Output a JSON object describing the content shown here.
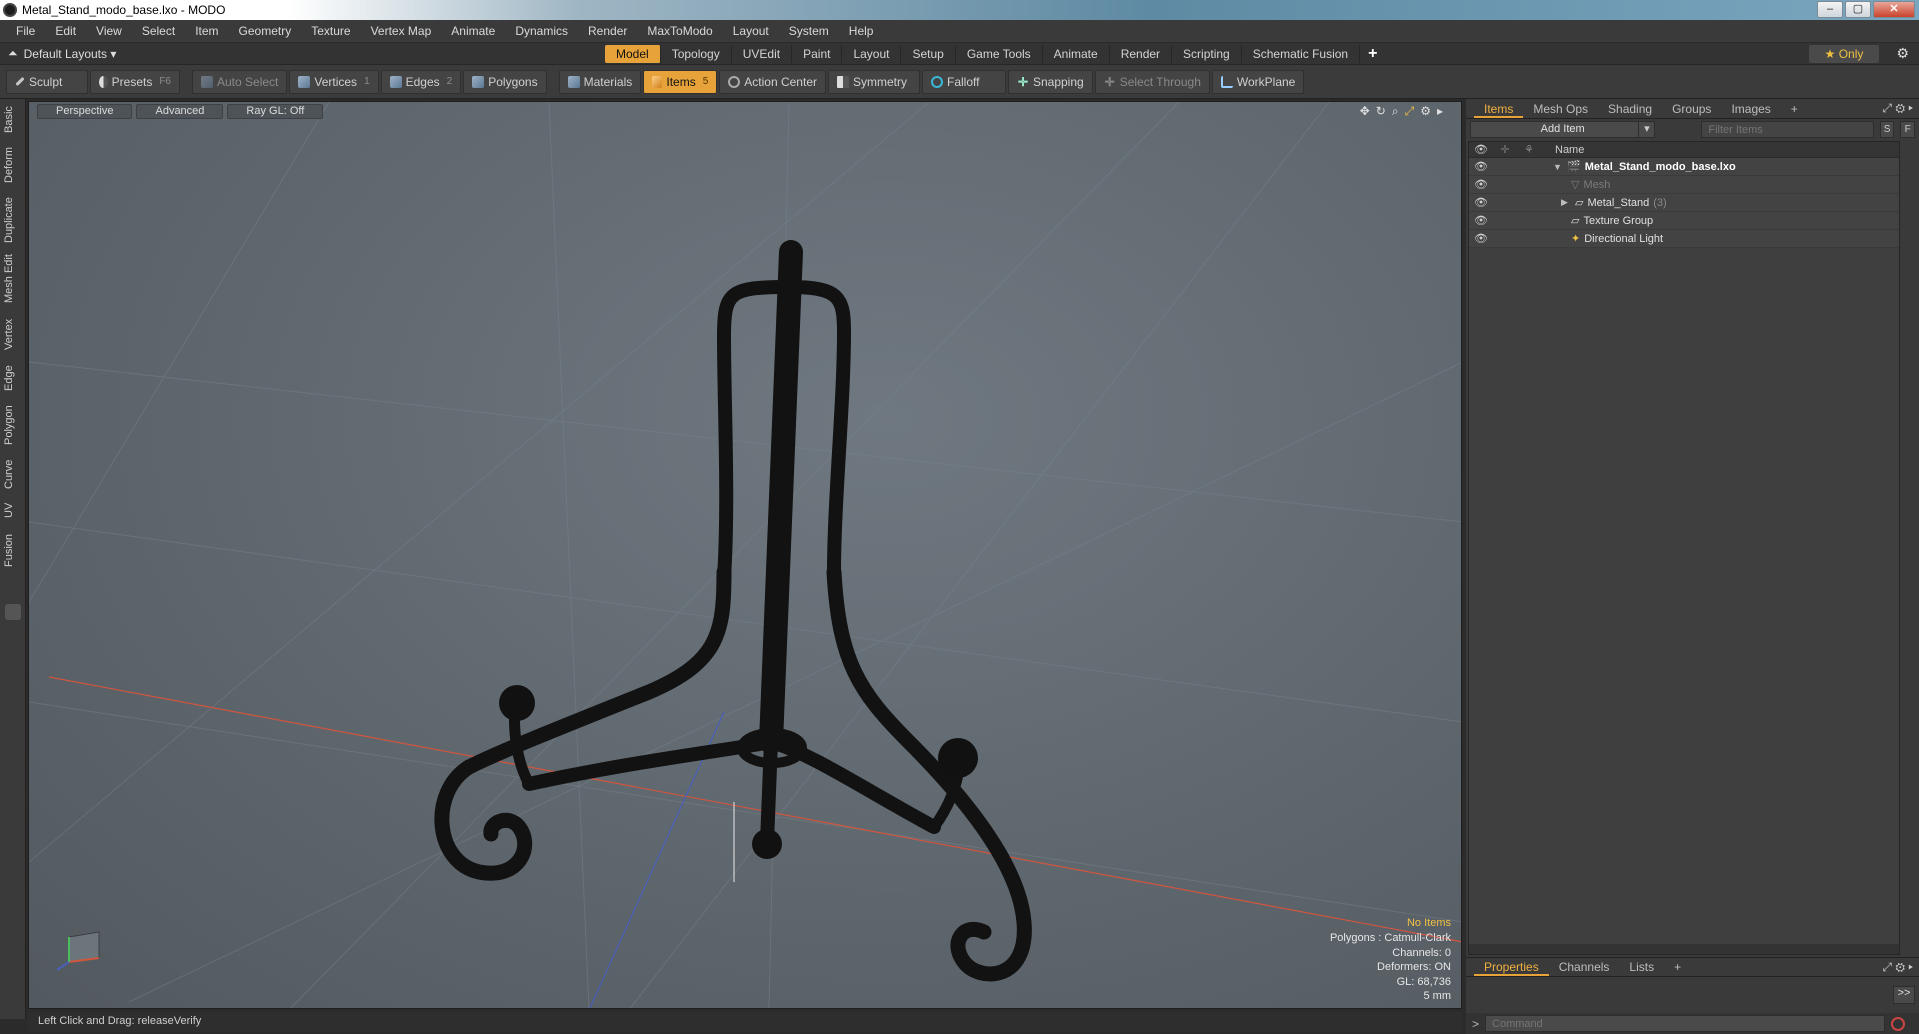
{
  "window": {
    "title": "Metal_Stand_modo_base.lxo - MODO",
    "minimize": "–",
    "maximize": "▢",
    "close": "✕"
  },
  "menu": [
    "File",
    "Edit",
    "View",
    "Select",
    "Item",
    "Geometry",
    "Texture",
    "Vertex Map",
    "Animate",
    "Dynamics",
    "Render",
    "MaxToModo",
    "Layout",
    "System",
    "Help"
  ],
  "layout": {
    "selector": "Default Layouts ▾",
    "tabs": [
      "Model",
      "Topology",
      "UVEdit",
      "Paint",
      "Layout",
      "Setup",
      "Game Tools",
      "Animate",
      "Render",
      "Scripting",
      "Schematic Fusion"
    ],
    "active_tab": "Model",
    "add": "+",
    "only": "★  Only"
  },
  "toolbar": {
    "sculpt": "Sculpt",
    "presets": "Presets",
    "presets_key": "F6",
    "auto_select": "Auto Select",
    "vertices": "Vertices",
    "vertices_key": "1",
    "edges": "Edges",
    "edges_key": "2",
    "polygons": "Polygons",
    "materials": "Materials",
    "items": "Items",
    "items_key": "5",
    "action_center": "Action Center",
    "symmetry": "Symmetry",
    "falloff": "Falloff",
    "snapping": "Snapping",
    "select_through": "Select Through",
    "workplane": "WorkPlane"
  },
  "left_tabs": [
    "Basic",
    "Deform",
    "Duplicate",
    "Mesh Edit",
    "Vertex",
    "Edge",
    "Polygon",
    "Curve",
    "UV",
    "Fusion"
  ],
  "viewport": {
    "view": "Perspective",
    "shading": "Advanced",
    "raygl": "Ray GL: Off",
    "info": {
      "selection": "No Items",
      "polygons": "Polygons : Catmull-Clark",
      "channels": "Channels: 0",
      "deformers": "Deformers: ON",
      "gl": "GL: 68,736",
      "unit": "5 mm"
    }
  },
  "status": "Left Click and Drag:  releaseVerify",
  "items_panel": {
    "tabs": [
      "Items",
      "Mesh Ops",
      "Shading",
      "Groups",
      "Images",
      "+"
    ],
    "active_tab": "Items",
    "add_item": "Add Item",
    "filter_placeholder": "Filter Items",
    "s_btn": "S",
    "f_btn": "F",
    "column_name": "Name",
    "rows": [
      {
        "name": "Metal_Stand_modo_base.lxo",
        "count": ""
      },
      {
        "name": "Mesh",
        "count": ""
      },
      {
        "name": "Metal_Stand",
        "count": "(3)"
      },
      {
        "name": "Texture Group",
        "count": ""
      },
      {
        "name": "Directional Light",
        "count": ""
      }
    ]
  },
  "properties_panel": {
    "tabs": [
      "Properties",
      "Channels",
      "Lists",
      "+"
    ],
    "active_tab": "Properties",
    "expand": ">>",
    "command_placeholder": "Command"
  },
  "colors": {
    "accent": "#e7a33a",
    "viewport_bg": "#5f676e",
    "object": "#111111",
    "x_axis": "#d2553e",
    "z_axis": "#4a5fb8"
  }
}
